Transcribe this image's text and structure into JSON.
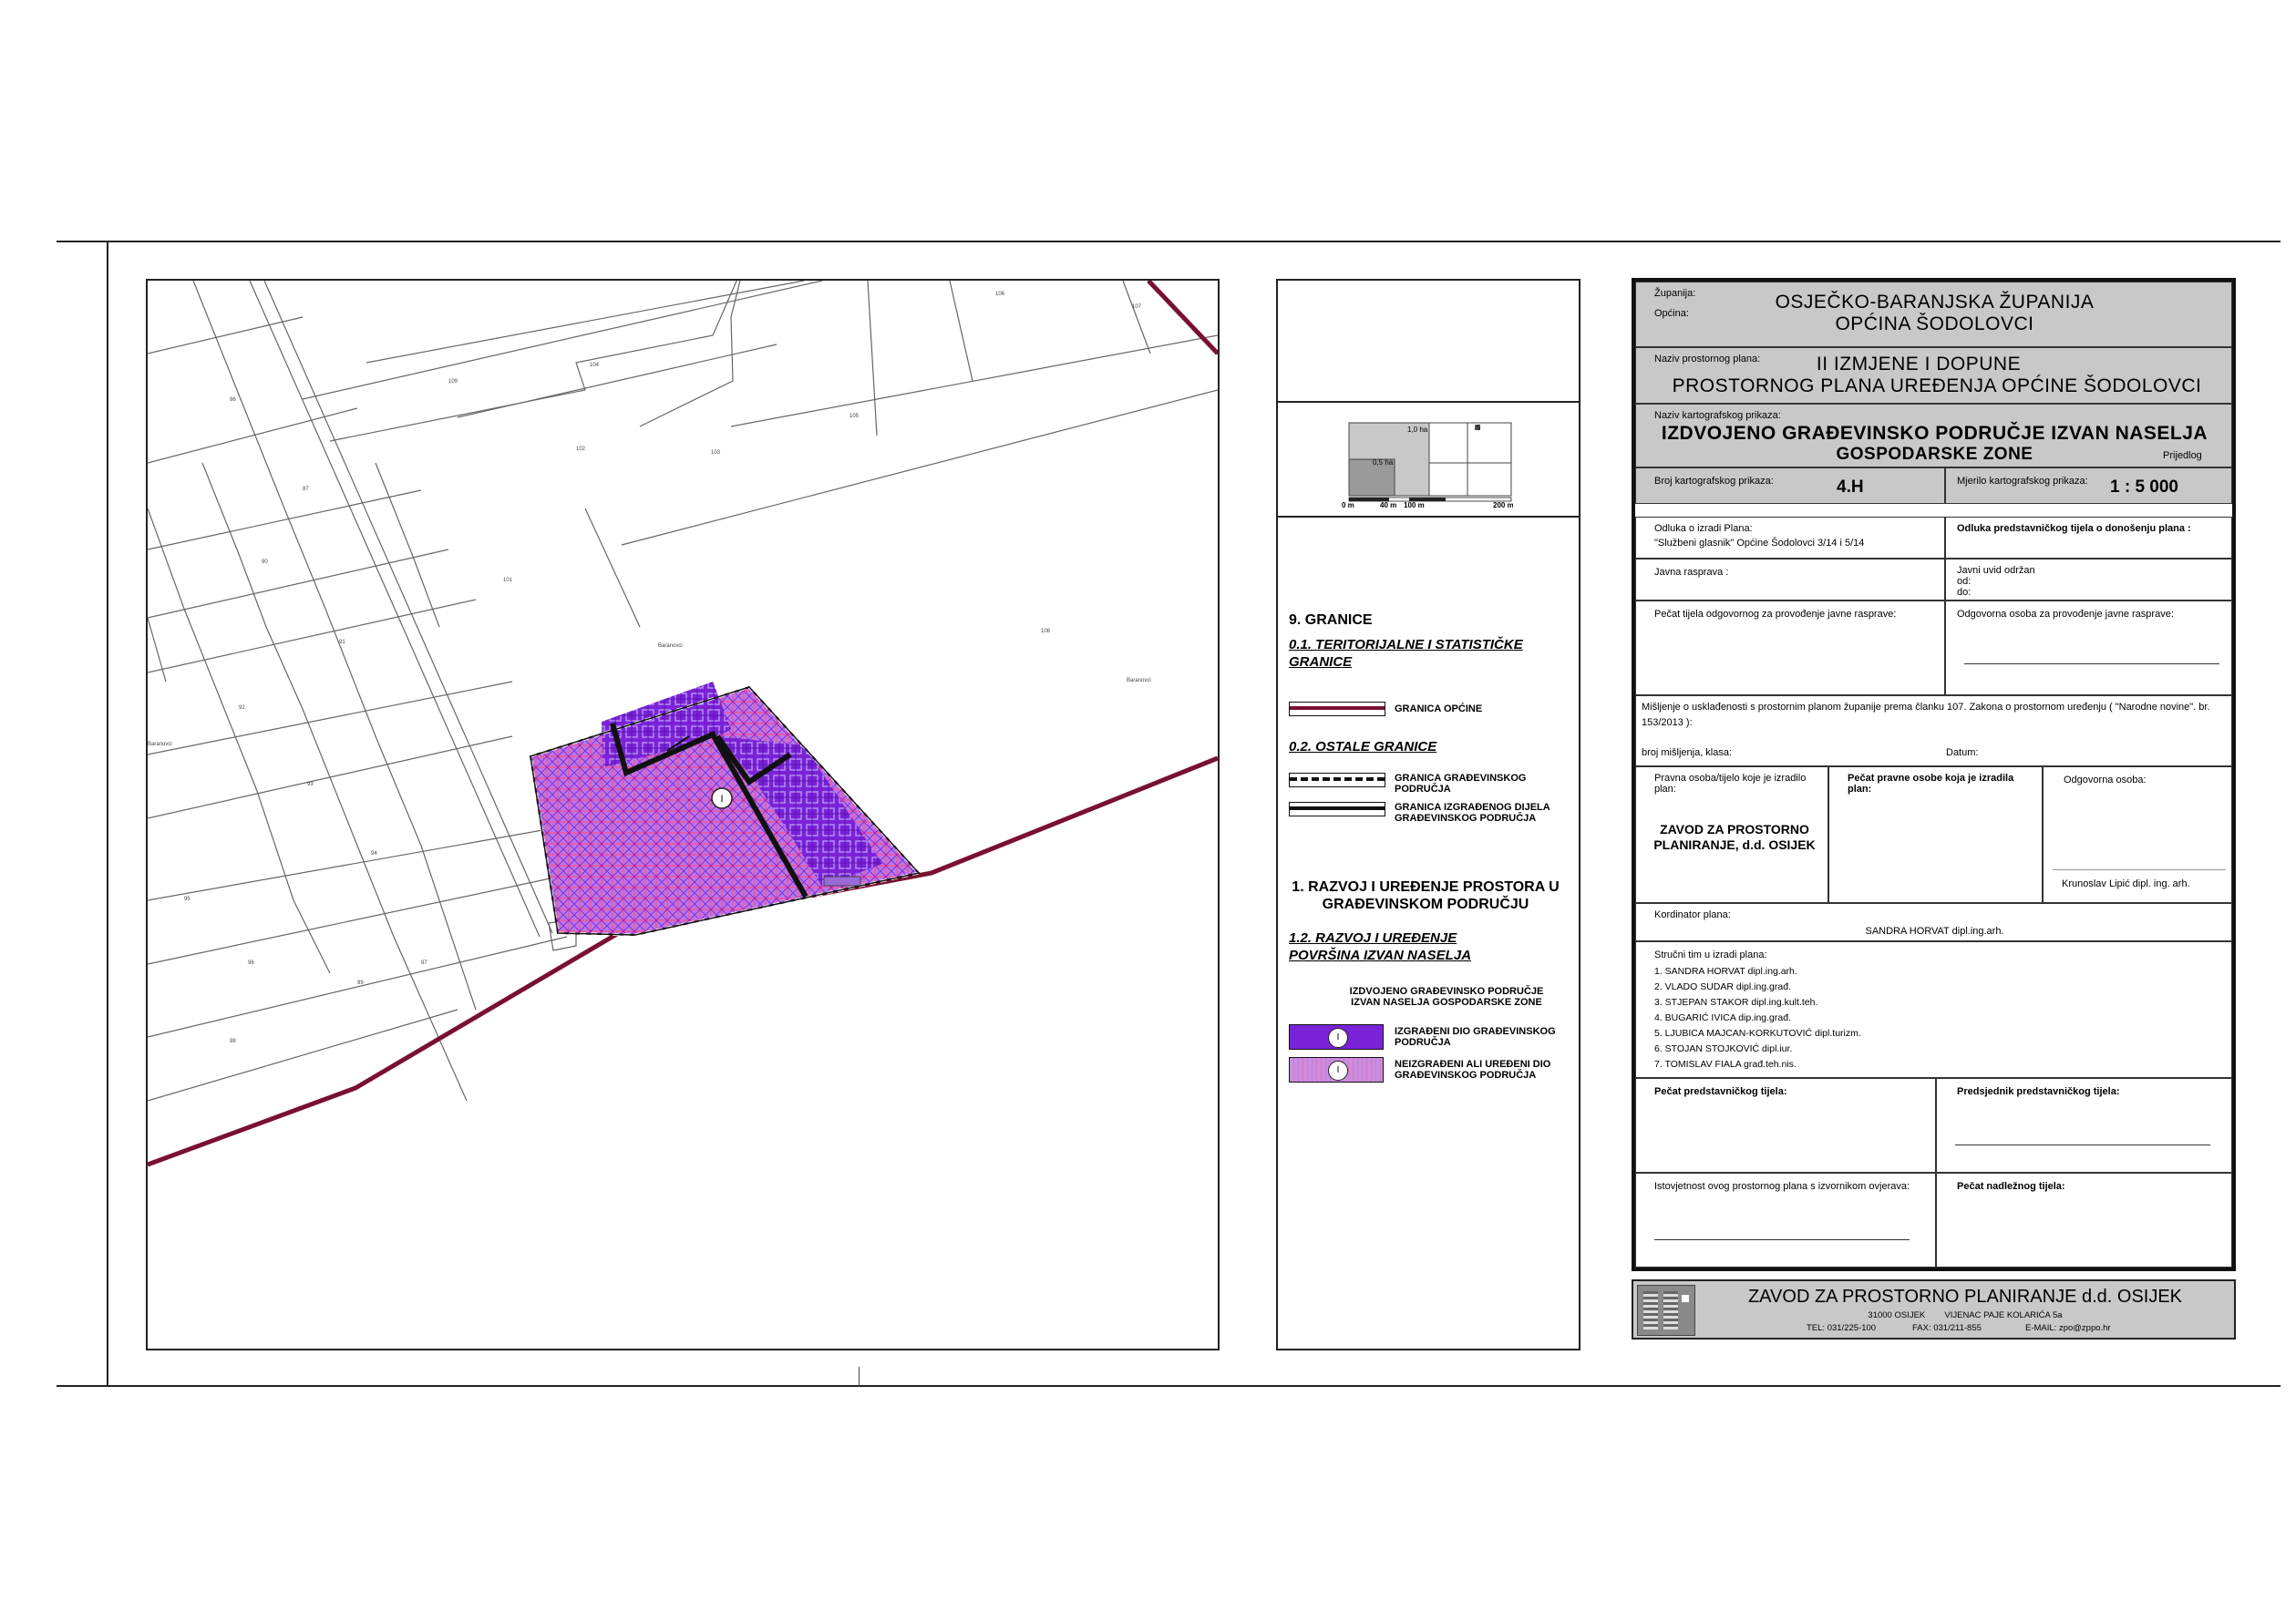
{
  "map": {
    "scale_bar": {
      "area_labels": [
        "1,0 ha",
        "0,5 ha",
        "5"
      ],
      "distance_labels": [
        "0 m",
        "40 m",
        "100 m",
        "200 m"
      ]
    },
    "zone_marker": "I",
    "place_labels": [
      "Baranovci",
      "Baranovci"
    ]
  },
  "legend": {
    "section_9": "9. GRANICE",
    "sub_01": "0.1. TERITORIJALNE I STATISTIČKE GRANICE",
    "item_opcina": "GRANICA OPĆINE",
    "sub_02": "0.2. OSTALE GRANICE",
    "item_gp": "GRANICA GRAĐEVINSKOG PODRUČJA",
    "item_izgp": "GRANICA IZGRAĐENOG DIJELA GRAĐEVINSKOG PODRUČJA",
    "section_1": "1. RAZVOJ I UREĐENJE PROSTORA U GRAĐEVINSKOM PODRUČJU",
    "sub_12": "1.2. RAZVOJ I UREĐENJE POVRŠINA IZVAN NASELJA",
    "zone_title": "IZDVOJENO GRAĐEVINSKO PODRUČJE IZVAN NASELJA GOSPODARSKE ZONE",
    "item_built": "IZGRAĐENI DIO GRAĐEVINSKOG PODRUČJA",
    "item_unbuilt": "NEIZGRAĐENI ALI UREĐENI DIO GRAĐEVINSKOG PODRUČJA",
    "swatch_label": "I"
  },
  "title_block": {
    "zupanija_label": "Županija:",
    "opcina_label": "Općina:",
    "zupanija": "OSJEČKO-BARANJSKA ŽUPANIJA",
    "opcina": "OPĆINA ŠODOLOVCI",
    "plan_label": "Naziv prostornog plana:",
    "plan_line1": "II IZMJENE I DOPUNE",
    "plan_line2": "PROSTORNOG PLANA UREĐENJA OPĆINE ŠODOLOVCI",
    "prikaz_label": "Naziv kartografskog prikaza:",
    "prikaz_line1": "IZDVOJENO GRAĐEVINSKO PODRUČJE IZVAN NASELJA",
    "prikaz_line2": "GOSPODARSKE ZONE",
    "prijedlog": "Prijedlog",
    "broj_label": "Broj kartografskog prikaza:",
    "broj": "4.H",
    "mjerilo_label": "Mjerilo kartografskog prikaza:",
    "mjerilo": "1 : 5 000",
    "odluka_izradi_label": "Odluka o izradi Plana:",
    "odluka_izradi": "\"Službeni glasnik\" Općine Šodolovci 3/14 i 5/14",
    "odluka_donosenju": "Odluka predstavničkog tijela o donošenju plana :",
    "javna_rasprava": "Javna rasprava :",
    "javni_uvid": "Javni uvid održan",
    "od": "od:",
    "do": "do:",
    "pecat_javne": "Pečat tijela odgovornog za provođenje javne rasprave:",
    "odgovorna_javne": "Odgovorna osoba za provođenje javne rasprave:",
    "misljenje": "Mišljenje o usklađenosti s prostornim planom županije prema članku 107. Zakona o prostornom uređenju ( \"Narodne novine\". br. 153/2013 ):",
    "broj_misljenja": "broj mišljenja, klasa:",
    "datum": "Datum:",
    "pravna_osoba": "Pravna osoba/tijelo koje je izradilo plan:",
    "izradio": "ZAVOD ZA PROSTORNO PLANIRANJE, d.d. OSIJEK",
    "pecat_pravne": "Pečat pravne osobe koja je izradila plan:",
    "odgovorna_osoba": "Odgovorna osoba:",
    "odgovorna_ime": "Krunoslav Lipić dipl. ing. arh.",
    "koordinator_label": "Kordinator plana:",
    "koordinator": "SANDRA HORVAT dipl.ing.arh.",
    "tim_label": "Stručni tim u izradi plana:",
    "tim": [
      "1.   SANDRA HORVAT dipl.ing.arh.",
      "2.   VLADO SUDAR dipl.ing.građ.",
      "3.   STJEPAN STAKOR dipl.ing.kult.teh.",
      "4.   BUGARIĆ IVICA dip.ing.građ.",
      "5.   LJUBICA MAJCAN-KORKUTOVIĆ dipl.turizm.",
      "6.   STOJAN STOJKOVIĆ dipl.iur.",
      "7.   TOMISLAV FIALA građ.teh.nis."
    ],
    "pecat_predst": "Pečat predstavničkog tijela:",
    "predsjednik": "Predsjednik predstavničkog tijela:",
    "istovjetnost": "Istovjetnost ovog prostornog plana s izvornikom ovjerava:",
    "pecat_nadlezni": "Pečat nadležnog tijela:"
  },
  "footer": {
    "company": "ZAVOD ZA PROSTORNO PLANIRANJE d.d. OSIJEK",
    "address": "31000 OSIJEK        VIJENAC PAJE KOLARIĆA 5a",
    "tel": "TEL: 031/225-100",
    "fax": "FAX: 031/211-855",
    "email": "E-MAIL: zpo@zppo.hr"
  },
  "colors": {
    "boundary_municipality": "#7a1030",
    "zone_purple": "#7a22d8",
    "title_gray": "#c8c8c8"
  }
}
